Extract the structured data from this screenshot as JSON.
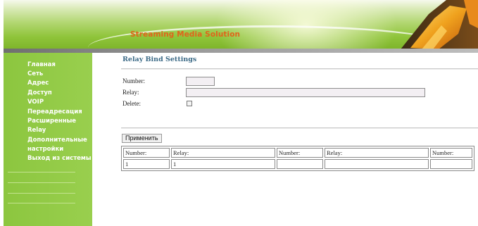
{
  "header": {
    "title": "Streaming Media Solution"
  },
  "sidebar": {
    "items": [
      {
        "label": "Главная"
      },
      {
        "label": "Сеть"
      },
      {
        "label": "Адрес"
      },
      {
        "label": "Доступ"
      },
      {
        "label": "VOIP"
      },
      {
        "label": "Переадресация"
      },
      {
        "label": "Расширенные"
      },
      {
        "label": "Relay"
      },
      {
        "label": "Дополнительные"
      },
      {
        "label": "настройки"
      },
      {
        "label": "Выход из системы"
      }
    ]
  },
  "main": {
    "title": "Relay Bind Settings",
    "form": {
      "number_label": "Number:",
      "number_value": "",
      "relay_label": "Relay:",
      "relay_value": "",
      "delete_label": "Delete:",
      "delete_checked": false
    },
    "apply_label": "Применить",
    "table": {
      "headers": [
        "Number:",
        "Relay:",
        "Number:",
        "Relay:",
        "Number:"
      ],
      "rows": [
        [
          "1",
          "1",
          "",
          "",
          ""
        ]
      ]
    }
  },
  "colors": {
    "sidebar": "#8cc63f",
    "banner_title": "#e0641b",
    "page_title": "#3d6b87"
  }
}
